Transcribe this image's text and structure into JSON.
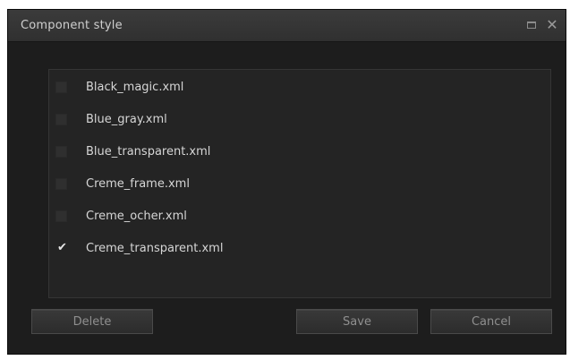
{
  "window": {
    "title": "Component style"
  },
  "list": {
    "items": [
      {
        "label": "Black_magic.xml",
        "checked": false
      },
      {
        "label": "Blue_gray.xml",
        "checked": false
      },
      {
        "label": "Blue_transparent.xml",
        "checked": false
      },
      {
        "label": "Creme_frame.xml",
        "checked": false
      },
      {
        "label": "Creme_ocher.xml",
        "checked": false
      },
      {
        "label": "Creme_transparent.xml",
        "checked": true
      }
    ]
  },
  "buttons": {
    "delete": "Delete",
    "save": "Save",
    "cancel": "Cancel"
  },
  "icons": {
    "maximize": "maximize-icon",
    "close": "close-icon",
    "check": "check-icon"
  },
  "colors": {
    "window_bg": "#1d1d1d",
    "titlebar_bg": "#353535",
    "list_bg": "#242424",
    "text": "#d6d6d6"
  }
}
